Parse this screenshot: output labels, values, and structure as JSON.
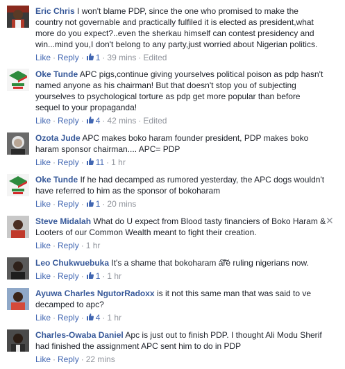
{
  "actions": {
    "like": "Like",
    "reply": "Reply",
    "edited": "Edited",
    "separator": "·"
  },
  "comments": [
    {
      "author": "Eric Chris",
      "text": "I won't blame PDP, since the one who promised to make the country not governable and practically fulfiled it is elected as president,what more do you expect?..even the sherkau himself can contest presidency and win...mind you,I don't belong to any party,just worried about Nigerian politics.",
      "likes": "1",
      "time": "39 mins",
      "edited": true,
      "avatar": "portrait-dark"
    },
    {
      "author": "Oke Tunde",
      "text": "APC pigs,continue giving yourselves political poison as pdp hasn't named anyone as his chairman! But that doesn't stop you of subjecting yourselves to psychological torture as pdp get more popular than before sequel to your propaganda!",
      "likes": "4",
      "time": "42 mins",
      "edited": true,
      "avatar": "pdp-logo"
    },
    {
      "author": "Ozota Jude",
      "text": "APC makes boko haram founder president, PDP makes boko haram sponsor chairman.... APC= PDP",
      "likes": "11",
      "time": "1 hr",
      "edited": false,
      "avatar": "portrait-grey"
    },
    {
      "author": "Oke Tunde",
      "text": "If he had decamped as rumored yesterday, the APC dogs wouldn't have referred to him as the sponsor of bokoharam",
      "likes": "1",
      "time": "20 mins",
      "edited": false,
      "avatar": "pdp-logo"
    },
    {
      "author": "Steve Midalah",
      "text": "What do U expect from Blood tasty financiers of Boko Haram & Looters of our Common Wealth meant to fight their creation.",
      "likes": "",
      "time": "1 hr",
      "edited": false,
      "avatar": "portrait-red",
      "close": "✕"
    },
    {
      "author": "Leo Chukwuebuka",
      "text": "It's a shame that bokoharam a͠r͠e ruling nigerians now.",
      "likes": "1",
      "time": "1 hr",
      "edited": false,
      "avatar": "portrait-dark2"
    },
    {
      "author": "Ayuwa Charles NgutorRadoxx",
      "text": "is it not this same man that was said to ve decamped to apc?",
      "likes": "4",
      "time": "1 hr",
      "edited": false,
      "avatar": "portrait-blue"
    },
    {
      "author": "Charles-Owaba Daniel",
      "text": "Apc is just out to finish PDP. I thought Ali Modu Sherif had finished the assignment APC sent him to do in PDP",
      "likes": "",
      "time": "22 mins",
      "edited": false,
      "avatar": "portrait-dark3"
    }
  ]
}
